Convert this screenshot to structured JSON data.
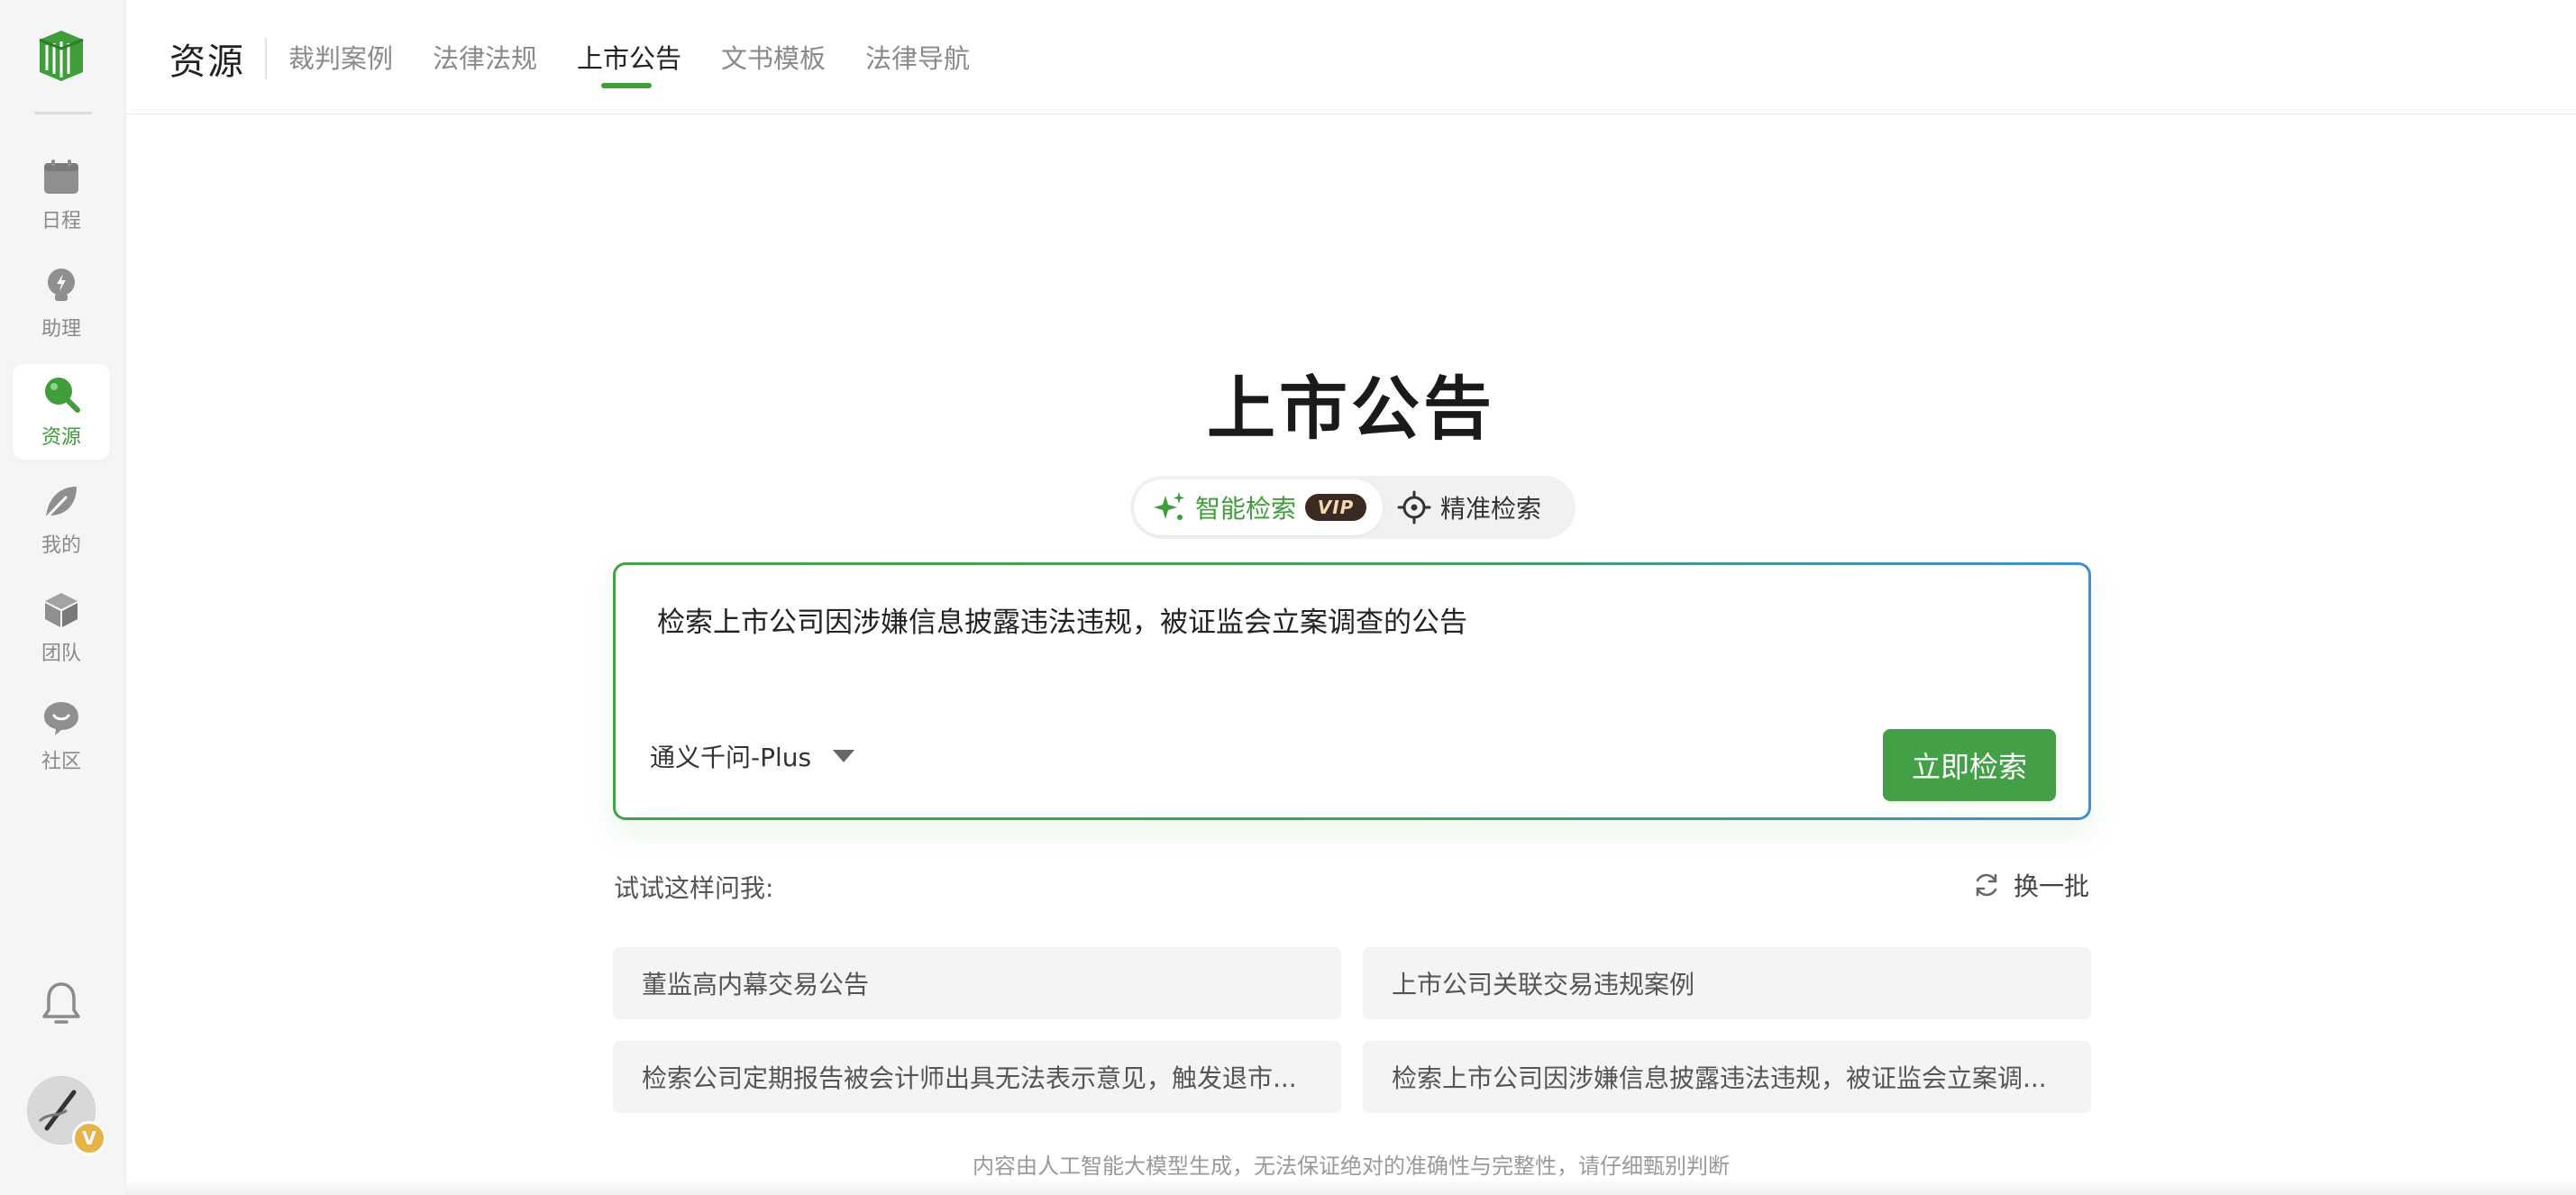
{
  "sidebar": {
    "items": [
      {
        "label": "日程",
        "icon": "calendar-icon"
      },
      {
        "label": "助理",
        "icon": "lightbulb-icon"
      },
      {
        "label": "资源",
        "icon": "search-icon",
        "active": true
      },
      {
        "label": "我的",
        "icon": "leaf-icon"
      },
      {
        "label": "团队",
        "icon": "cube-icon"
      },
      {
        "label": "社区",
        "icon": "chat-bubble-icon"
      }
    ],
    "avatar_badge": "V"
  },
  "header": {
    "title": "资源",
    "tabs": [
      {
        "label": "裁判案例"
      },
      {
        "label": "法律法规"
      },
      {
        "label": "上市公告",
        "active": true
      },
      {
        "label": "文书模板"
      },
      {
        "label": "法律导航"
      }
    ]
  },
  "main": {
    "title": "上市公告",
    "modes": {
      "smart_label": "智能检索",
      "vip_label": "VIP",
      "precise_label": "精准检索"
    },
    "search": {
      "value": "检索上市公司因涉嫌信息披露违法违规，被证监会立案调查的公告",
      "model": "通义千问-Plus",
      "button": "立即检索"
    },
    "try_label": "试试这样问我:",
    "refresh_label": "换一批",
    "suggestions": [
      "董监高内幕交易公告",
      "上市公司关联交易违规案例",
      "检索公司定期报告被会计师出具无法表示意见，触发退市...",
      "检索上市公司因涉嫌信息披露违法违规，被证监会立案调..."
    ],
    "footer": "内容由人工智能大模型生成，无法保证绝对的准确性与完整性，请仔细甄别判断"
  },
  "colors": {
    "accent": "#3f9d3a",
    "button": "#43a047",
    "gradient_end": "#3f8fd4"
  }
}
